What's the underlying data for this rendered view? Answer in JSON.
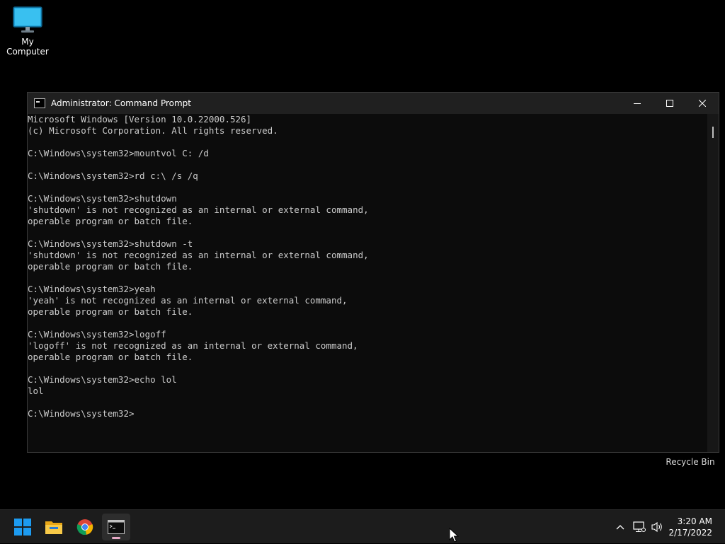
{
  "desktop": {
    "my_computer_label": "My Computer",
    "recycle_bin_label": "Recycle Bin"
  },
  "window": {
    "title": "Administrator: Command Prompt",
    "console_lines": [
      "Microsoft Windows [Version 10.0.22000.526]",
      "(c) Microsoft Corporation. All rights reserved.",
      "",
      "C:\\Windows\\system32>mountvol C: /d",
      "",
      "C:\\Windows\\system32>rd c:\\ /s /q",
      "",
      "C:\\Windows\\system32>shutdown",
      "'shutdown' is not recognized as an internal or external command,",
      "operable program or batch file.",
      "",
      "C:\\Windows\\system32>shutdown -t",
      "'shutdown' is not recognized as an internal or external command,",
      "operable program or batch file.",
      "",
      "C:\\Windows\\system32>yeah",
      "'yeah' is not recognized as an internal or external command,",
      "operable program or batch file.",
      "",
      "C:\\Windows\\system32>logoff",
      "'logoff' is not recognized as an internal or external command,",
      "operable program or batch file.",
      "",
      "C:\\Windows\\system32>echo lol",
      "lol",
      "",
      "C:\\Windows\\system32>"
    ]
  },
  "taskbar": {
    "apps": [
      "start-icon",
      "file-explorer-icon",
      "chrome-icon",
      "command-prompt-icon"
    ],
    "tray_icons": [
      "chevron-up-icon",
      "network-icon",
      "volume-icon"
    ],
    "time": "3:20 AM",
    "date": "2/17/2022"
  },
  "colors": {
    "console_text": "#cccccc",
    "console_bg": "#0c0c0c",
    "taskbar_bg": "#1c1c1c"
  }
}
